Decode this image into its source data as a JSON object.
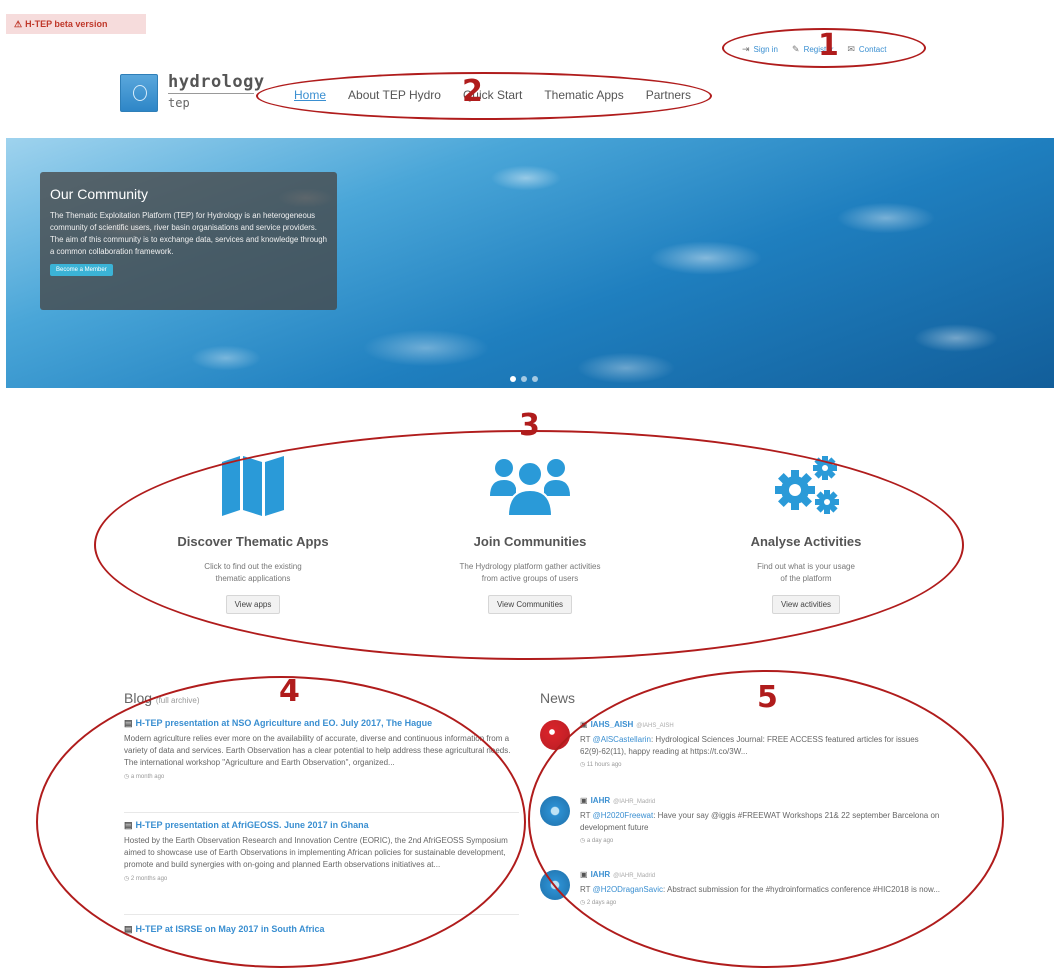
{
  "beta_banner": "H-TEP beta version",
  "top_links": {
    "sign_in": "Sign in",
    "register": "Register",
    "contact": "Contact"
  },
  "brand": {
    "main": "hydrology",
    "sub": "tep"
  },
  "nav": [
    "Home",
    "About TEP Hydro",
    "Quick Start",
    "Thematic Apps",
    "Partners"
  ],
  "hero": {
    "title": "Our Community",
    "text": "The Thematic Exploitation Platform (TEP) for Hydrology is an heterogeneous community of scientific users, river basin organisations and service providers. The aim of this community is to exchange data, services and knowledge through a common collaboration framework.",
    "button": "Become a Member"
  },
  "features": [
    {
      "title": "Discover Thematic Apps",
      "desc": "Click to find out the existing\nthematic applications",
      "button": "View apps",
      "icon": "map-icon"
    },
    {
      "title": "Join Communities",
      "desc": "The Hydrology platform gather activities\nfrom active groups of users",
      "button": "View Communities",
      "icon": "users-icon"
    },
    {
      "title": "Analyse Activities",
      "desc": "Find out what is your usage\nof the platform",
      "button": "View activities",
      "icon": "gears-icon"
    }
  ],
  "blog": {
    "title": "Blog",
    "archive": "(full archive)",
    "items": [
      {
        "title": "H-TEP presentation at NSO Agriculture and EO. July 2017, The Hague",
        "text": "Modern agriculture relies ever more on the availability of accurate, diverse and continuous information from a variety of data and services. Earth Observation has a clear potential to help address these agricultural needs. The international workshop \"Agriculture and Earth Observation\", organized...",
        "time": "a month ago"
      },
      {
        "title": "H-TEP presentation at AfriGEOSS. June 2017 in Ghana",
        "text": "Hosted by the Earth Observation Research and Innovation Centre (EORIC), the 2nd AfriGEOSS Symposium aimed to showcase use of Earth Observations in implementing African policies for sustainable development, promote and build synergies with on-going and planned Earth observations initiatives at...",
        "time": "2 months ago"
      },
      {
        "title": "H-TEP at ISRSE on May 2017 in South Africa",
        "text": "",
        "time": ""
      }
    ]
  },
  "news": {
    "title": "News",
    "items": [
      {
        "name": "IAHS_AISH",
        "handle": "@IAHS_AISH",
        "prefix": "RT ",
        "mention": "@AlSCastellarin",
        "text": ": Hydrological Sciences Journal: FREE ACCESS featured articles for issues 62(9)-62(11), happy reading at https://t.co/3W...",
        "time": "11 hours ago"
      },
      {
        "name": "IAHR",
        "handle": "@IAHR_Madrid",
        "prefix": "RT ",
        "mention": "@H2020Freewat",
        "text": ": Have your say @iggis #FREEWAT Workshops 21& 22 september Barcelona on development future",
        "time": "a day ago"
      },
      {
        "name": "IAHR",
        "handle": "@IAHR_Madrid",
        "prefix": "RT ",
        "mention": "@H2ODraganSavic",
        "text": ": Abstract submission for the #hydroinformatics conference #HIC2018 is now...",
        "time": "2 days ago"
      }
    ]
  },
  "annotations": [
    "1",
    "2",
    "3",
    "4",
    "5"
  ],
  "colors": {
    "accent": "#3a8fd1",
    "annotation": "#b01c1c",
    "icon_blue": "#2a9ad8"
  }
}
